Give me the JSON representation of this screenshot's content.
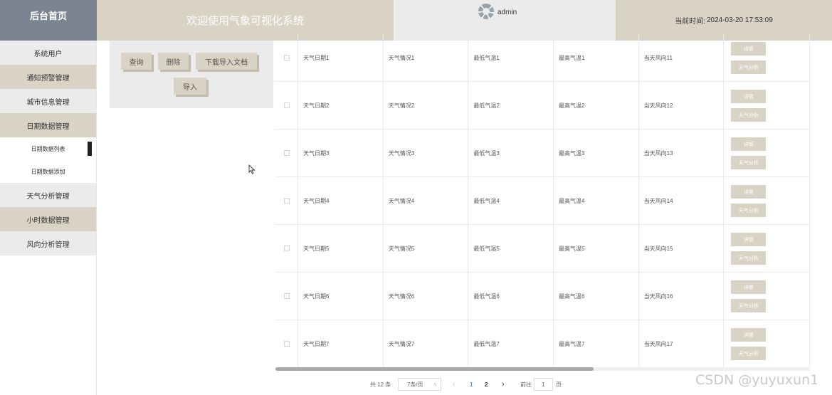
{
  "header": {
    "brand": "后台首页",
    "welcome": "欢迎使用气象可视化系统",
    "username": "admin",
    "time_label": "当前时间:",
    "time_value": "2024-03-20 17:53:09"
  },
  "sidebar": {
    "items": [
      {
        "label": "系统用户"
      },
      {
        "label": "通知预警管理"
      },
      {
        "label": "城市信息管理"
      },
      {
        "label": "日期数据管理"
      },
      {
        "label": "日期数据列表"
      },
      {
        "label": "日期数据添加"
      },
      {
        "label": "天气分析管理"
      },
      {
        "label": "小时数据管理"
      },
      {
        "label": "风向分析管理"
      }
    ]
  },
  "toolbar": {
    "query": "查询",
    "delete": "删除",
    "download_template": "下载导入文档",
    "import": "导入"
  },
  "table": {
    "detail_label": "详情",
    "analysis_label": "天气分析",
    "rows": [
      [
        "天气日期1",
        "天气情况1",
        "最低气温1",
        "最高气温1",
        "当天风向11"
      ],
      [
        "天气日期2",
        "天气情况2",
        "最低气温2",
        "最高气温2",
        "当天风向12"
      ],
      [
        "天气日期3",
        "天气情况3",
        "最低气温3",
        "最高气温3",
        "当天风向13"
      ],
      [
        "天气日期4",
        "天气情况4",
        "最低气温4",
        "最高气温4",
        "当天风向14"
      ],
      [
        "天气日期5",
        "天气情况5",
        "最低气温5",
        "最高气温5",
        "当天风向15"
      ],
      [
        "天气日期6",
        "天气情况6",
        "最低气温6",
        "最高气温6",
        "当天风向16"
      ],
      [
        "天气日期7",
        "天气情况7",
        "最低气温7",
        "最高气温7",
        "当天风向17"
      ]
    ]
  },
  "pagination": {
    "total": "共 12 条",
    "page_size": "7条/页",
    "prev": "‹",
    "pages": [
      "1",
      "2"
    ],
    "next": "›",
    "goto": "前往",
    "goto_value": "1",
    "page_suffix": "页"
  },
  "watermark": "CSDN @yuyuxun1",
  "colors": {
    "brand_bg": "#7b8591",
    "accent_beige": "#d8d3c5",
    "light_gray": "#ebebeb",
    "active_page": "#409eff"
  }
}
